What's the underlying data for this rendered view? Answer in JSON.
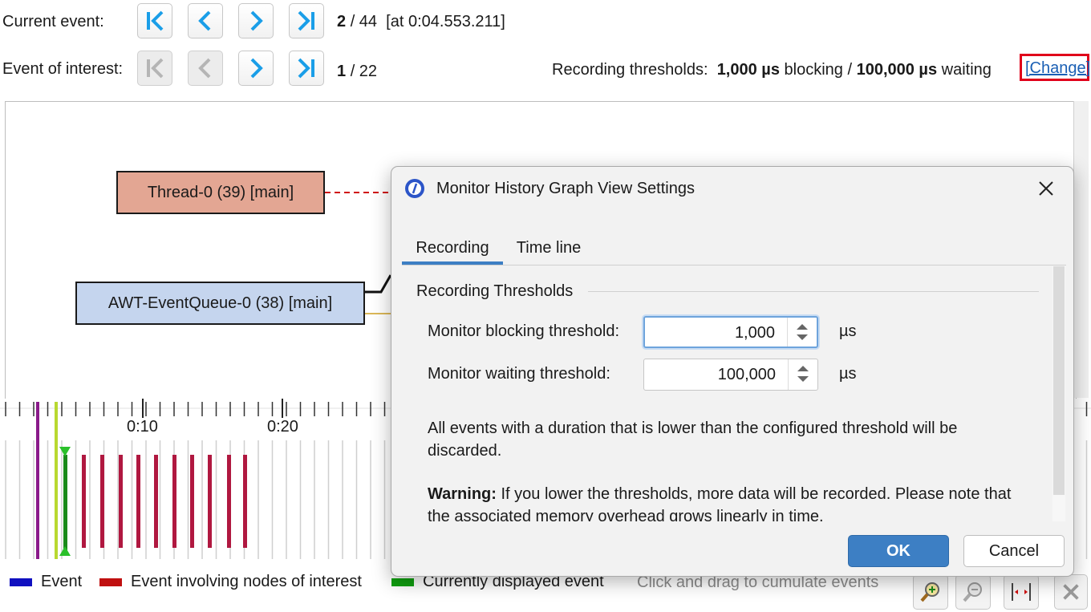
{
  "nav": {
    "current_label": "Current event:",
    "current_index": "2",
    "current_total": "/ 44",
    "current_time": "[at 0:04.553.211]",
    "interest_label": "Event of interest:",
    "interest_index": "1",
    "interest_total": "/ 22"
  },
  "thresholds": {
    "label": "Recording thresholds:",
    "blocking_value": "1,000 µs",
    "blocking_word": "blocking /",
    "waiting_value": "100,000 µs",
    "waiting_word": "waiting",
    "change_link": "[Change]"
  },
  "graph": {
    "nodes": [
      {
        "label": "Thread-0 (39) [main]",
        "color": "#e3a693"
      },
      {
        "label": "AWT-EventQueue-0 (38) [main]",
        "color": "#c5d5ee"
      }
    ]
  },
  "timeline": {
    "ticks": [
      "0:10",
      "0:20"
    ]
  },
  "legend": {
    "event": "Event",
    "event_color": "#1010c0",
    "interest": "Event involving nodes of interest",
    "interest_color": "#c01010",
    "current": "Currently displayed event",
    "current_color": "#10a010",
    "hint": "Click and drag to cumulate events"
  },
  "toolbar": {
    "zoom_in_icon": "zoom-in-icon",
    "zoom_out_icon": "zoom-out-icon",
    "fit_icon": "fit-width-icon",
    "close_icon": "close-icon"
  },
  "dialog": {
    "title": "Monitor History Graph View Settings",
    "tabs": [
      {
        "label": "Recording",
        "selected": true
      },
      {
        "label": "Time line",
        "selected": false
      }
    ],
    "group_title": "Recording Thresholds",
    "blocking_label": "Monitor blocking threshold:",
    "blocking_value": "1,000",
    "blocking_unit": "µs",
    "waiting_label": "Monitor waiting threshold:",
    "waiting_value": "100,000",
    "waiting_unit": "µs",
    "info_text": "All events with a duration that is lower than the configured threshold will be discarded.",
    "warning_bold": "Warning:",
    "warning_text": " If you lower the thresholds, more data will be recorded. Please note that the associated memory overhead grows linearly in time.",
    "ok_label": "OK",
    "cancel_label": "Cancel",
    "accent_color": "#3d7fc4"
  }
}
